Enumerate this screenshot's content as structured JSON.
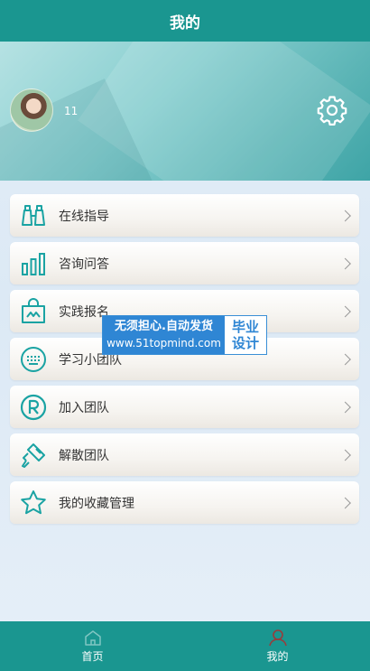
{
  "header": {
    "title": "我的"
  },
  "profile": {
    "username": "11"
  },
  "menu": [
    {
      "label": "在线指导",
      "icon": "binoculars-icon"
    },
    {
      "label": "咨询问答",
      "icon": "bar-chart-icon"
    },
    {
      "label": "实践报名",
      "icon": "shopping-bag-icon"
    },
    {
      "label": "学习小团队",
      "icon": "keyboard-icon"
    },
    {
      "label": "加入团队",
      "icon": "registered-r-icon"
    },
    {
      "label": "解散团队",
      "icon": "paint-roller-icon"
    },
    {
      "label": "我的收藏管理",
      "icon": "star-icon"
    }
  ],
  "watermark": {
    "line1": "无须担心.自动发货",
    "line2": "www.51topmind.com",
    "right1": "毕业",
    "right2": "设计"
  },
  "tabbar": [
    {
      "label": "首页",
      "icon": "home-icon"
    },
    {
      "label": "我的",
      "icon": "user-icon"
    }
  ],
  "colors": {
    "primary": "#1a9690",
    "icon": "#1aa3a3"
  }
}
